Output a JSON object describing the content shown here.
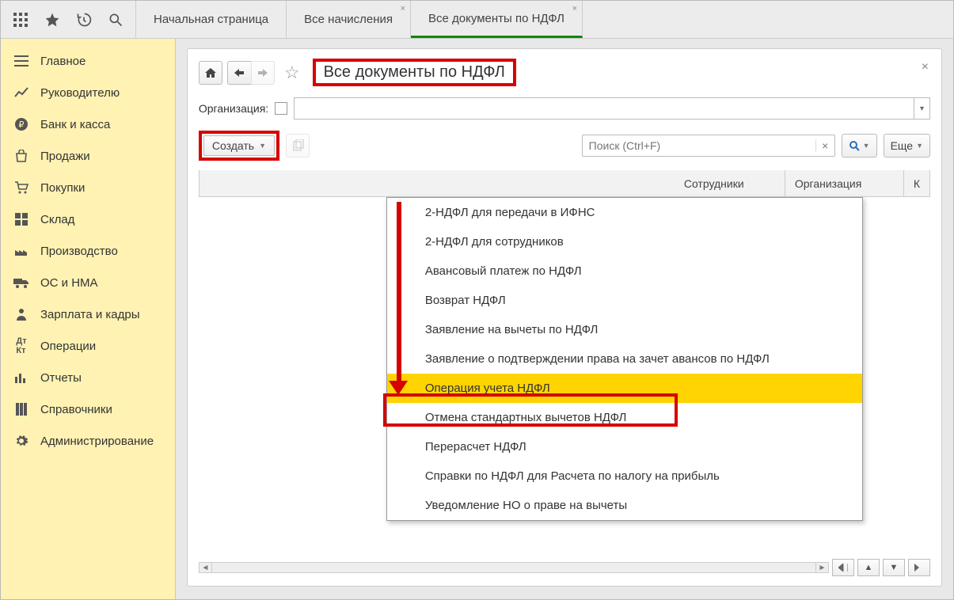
{
  "tabs": {
    "start": "Начальная страница",
    "all_accruals": "Все начисления",
    "all_docs": "Все документы по НДФЛ"
  },
  "sidebar": {
    "items": [
      {
        "label": "Главное"
      },
      {
        "label": "Руководителю"
      },
      {
        "label": "Банк и касса"
      },
      {
        "label": "Продажи"
      },
      {
        "label": "Покупки"
      },
      {
        "label": "Склад"
      },
      {
        "label": "Производство"
      },
      {
        "label": "ОС и НМА"
      },
      {
        "label": "Зарплата и кадры"
      },
      {
        "label": "Операции"
      },
      {
        "label": "Отчеты"
      },
      {
        "label": "Справочники"
      },
      {
        "label": "Администрирование"
      }
    ]
  },
  "panel": {
    "title": "Все документы по НДФЛ",
    "org_label": "Организация:",
    "create": "Создать",
    "search_placeholder": "Поиск (Ctrl+F)",
    "more": "Еще"
  },
  "table": {
    "col_employees": "Сотрудники",
    "col_org": "Организация",
    "col_k": "К"
  },
  "dropdown": {
    "items": [
      "2-НДФЛ для передачи в ИФНС",
      "2-НДФЛ для сотрудников",
      "Авансовый платеж по НДФЛ",
      "Возврат НДФЛ",
      "Заявление на вычеты по НДФЛ",
      "Заявление о подтверждении права на зачет авансов по НДФЛ",
      "Операция учета НДФЛ",
      "Отмена стандартных вычетов НДФЛ",
      "Перерасчет НДФЛ",
      "Справки по НДФЛ для Расчета по налогу на прибыль",
      "Уведомление НО о праве на вычеты"
    ]
  }
}
